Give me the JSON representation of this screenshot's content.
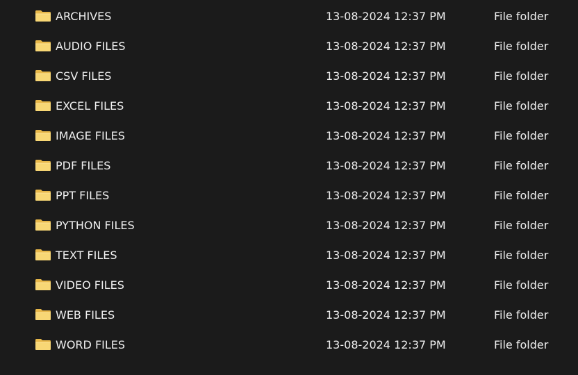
{
  "colors": {
    "background": "#1b1b1b",
    "text": "#f0f0f0",
    "folder_front": "#f8d775",
    "folder_back": "#e8b84a"
  },
  "files": [
    {
      "name": "ARCHIVES",
      "date_modified": "13-08-2024 12:37 PM",
      "type": "File folder",
      "icon": "folder-icon"
    },
    {
      "name": "AUDIO FILES",
      "date_modified": "13-08-2024 12:37 PM",
      "type": "File folder",
      "icon": "folder-icon"
    },
    {
      "name": "CSV FILES",
      "date_modified": "13-08-2024 12:37 PM",
      "type": "File folder",
      "icon": "folder-icon"
    },
    {
      "name": "EXCEL FILES",
      "date_modified": "13-08-2024 12:37 PM",
      "type": "File folder",
      "icon": "folder-icon"
    },
    {
      "name": "IMAGE FILES",
      "date_modified": "13-08-2024 12:37 PM",
      "type": "File folder",
      "icon": "folder-icon"
    },
    {
      "name": "PDF FILES",
      "date_modified": "13-08-2024 12:37 PM",
      "type": "File folder",
      "icon": "folder-icon"
    },
    {
      "name": "PPT FILES",
      "date_modified": "13-08-2024 12:37 PM",
      "type": "File folder",
      "icon": "folder-icon"
    },
    {
      "name": "PYTHON FILES",
      "date_modified": "13-08-2024 12:37 PM",
      "type": "File folder",
      "icon": "folder-icon"
    },
    {
      "name": "TEXT FILES",
      "date_modified": "13-08-2024 12:37 PM",
      "type": "File folder",
      "icon": "folder-icon"
    },
    {
      "name": "VIDEO FILES",
      "date_modified": "13-08-2024 12:37 PM",
      "type": "File folder",
      "icon": "folder-icon"
    },
    {
      "name": "WEB FILES",
      "date_modified": "13-08-2024 12:37 PM",
      "type": "File folder",
      "icon": "folder-icon"
    },
    {
      "name": "WORD FILES",
      "date_modified": "13-08-2024 12:37 PM",
      "type": "File folder",
      "icon": "folder-icon"
    }
  ]
}
